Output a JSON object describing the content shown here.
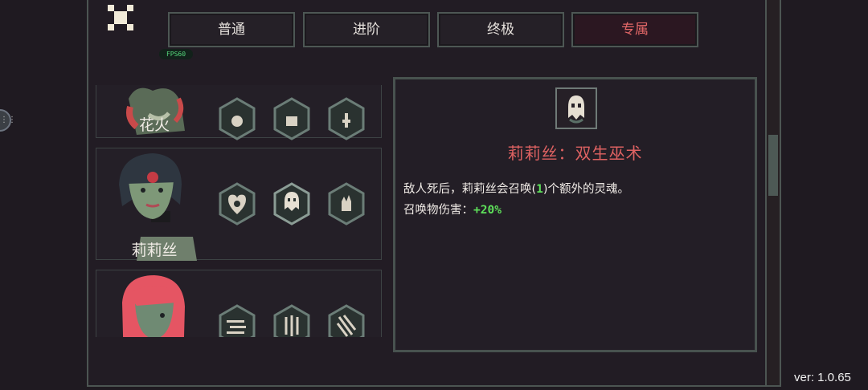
{
  "header": {
    "fps_label": "FPS60",
    "tabs": [
      {
        "label": "普通",
        "active": false
      },
      {
        "label": "进阶",
        "active": false
      },
      {
        "label": "终极",
        "active": false
      },
      {
        "label": "专属",
        "active": true
      }
    ]
  },
  "characters": [
    {
      "name": "花火",
      "skill_icons": [
        "skill-icon-1",
        "skill-icon-2",
        "skill-icon-3"
      ]
    },
    {
      "name": "莉莉丝",
      "skill_icons": [
        "skull-heart-icon",
        "ghost-icon",
        "spirit-hand-icon"
      ]
    },
    {
      "name": "",
      "skill_icons": [
        "bullets-icon",
        "spikes-icon",
        "claw-icon"
      ]
    }
  ],
  "detail": {
    "icon": "ghost-icon",
    "title": "莉莉丝：双生巫术",
    "desc_line1_before": "敌人死后，莉莉丝会召唤(",
    "desc_count": "1",
    "desc_line1_after": ")个额外的灵魂。",
    "desc_line2_label": "召唤物伤害：",
    "desc_line2_value": "+20%"
  },
  "version": "ver: 1.0.65",
  "colors": {
    "accent": "#df6262",
    "positive": "#5ee05a",
    "frame": "#4d5754"
  }
}
